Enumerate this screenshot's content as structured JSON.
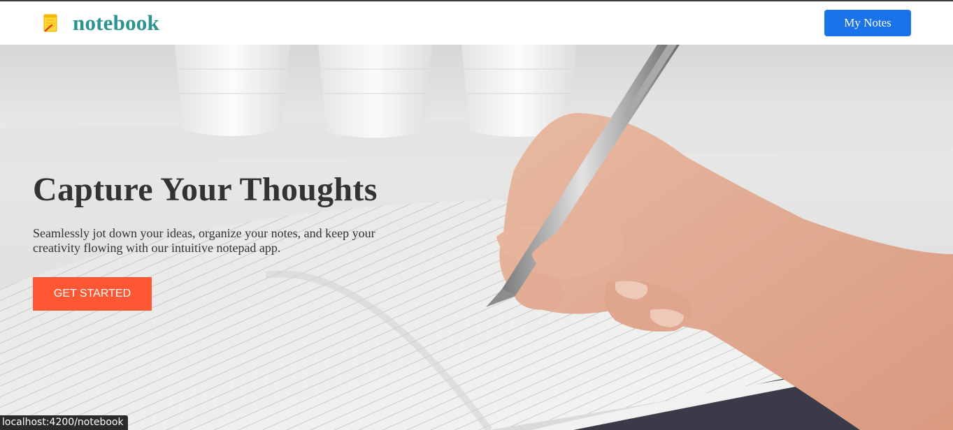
{
  "navbar": {
    "brand_icon": "notepad-icon",
    "brand_name": "notebook",
    "my_notes_label": "My Notes",
    "accent_color": "#2a9490",
    "button_color": "#1a73e8"
  },
  "hero": {
    "image": "hand-writing-in-notebook-photo",
    "title": "Capture Your Thoughts",
    "text": "Seamlessly jot down your ideas, organize your notes, and keep your creativity flowing with our intuitive notepad app.",
    "cta_label": "GET STARTED",
    "cta_color": "#ff5733"
  },
  "statusbar": {
    "url": "localhost:4200/notebook"
  }
}
